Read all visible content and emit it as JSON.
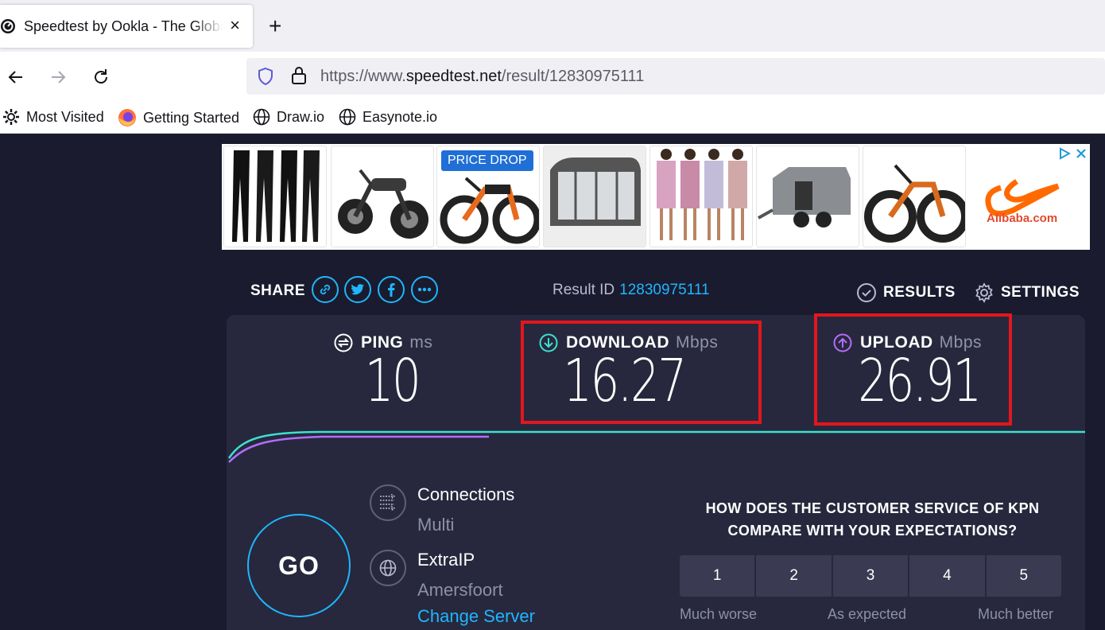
{
  "browser": {
    "tab_title": "Speedtest by Ookla - The Global Broadband Speed Test",
    "tab_close": "×",
    "new_tab": "+",
    "url_prefix": "https://www.",
    "url_domain": "speedtest.net",
    "url_path": "/result/12830975111",
    "bookmarks": [
      "Most Visited",
      "Getting Started",
      "Draw.io",
      "Easynote.io"
    ]
  },
  "ad": {
    "badge": "PRICE DROP",
    "brand": "Alibaba.com"
  },
  "share": {
    "label": "SHARE",
    "icons": [
      "link-icon",
      "twitter-icon",
      "facebook-icon",
      "more-icon"
    ]
  },
  "result": {
    "label": "Result ID",
    "id": "12830975111"
  },
  "top_links": {
    "results": "RESULTS",
    "settings": "SETTINGS"
  },
  "metrics": {
    "ping": {
      "label": "PING",
      "unit": "ms",
      "value": "10"
    },
    "download": {
      "label": "DOWNLOAD",
      "unit": "Mbps",
      "value": "16.27"
    },
    "upload": {
      "label": "UPLOAD",
      "unit": "Mbps",
      "value": "26.91"
    }
  },
  "go": "GO",
  "connections": {
    "title": "Connections",
    "value": "Multi"
  },
  "server": {
    "name": "ExtraIP",
    "location": "Amersfoort",
    "change": "Change Server"
  },
  "survey": {
    "question_line1": "HOW DOES THE CUSTOMER SERVICE OF KPN",
    "question_line2": "COMPARE WITH YOUR EXPECTATIONS?",
    "options": [
      "1",
      "2",
      "3",
      "4",
      "5"
    ],
    "low": "Much worse",
    "mid": "As expected",
    "high": "Much better"
  },
  "colors": {
    "background": "#1a1b2e",
    "panel": "#27283d",
    "accent": "#1fb6ff",
    "download": "#3ce0d0",
    "upload": "#b36dff",
    "highlight": "#e3161e"
  }
}
